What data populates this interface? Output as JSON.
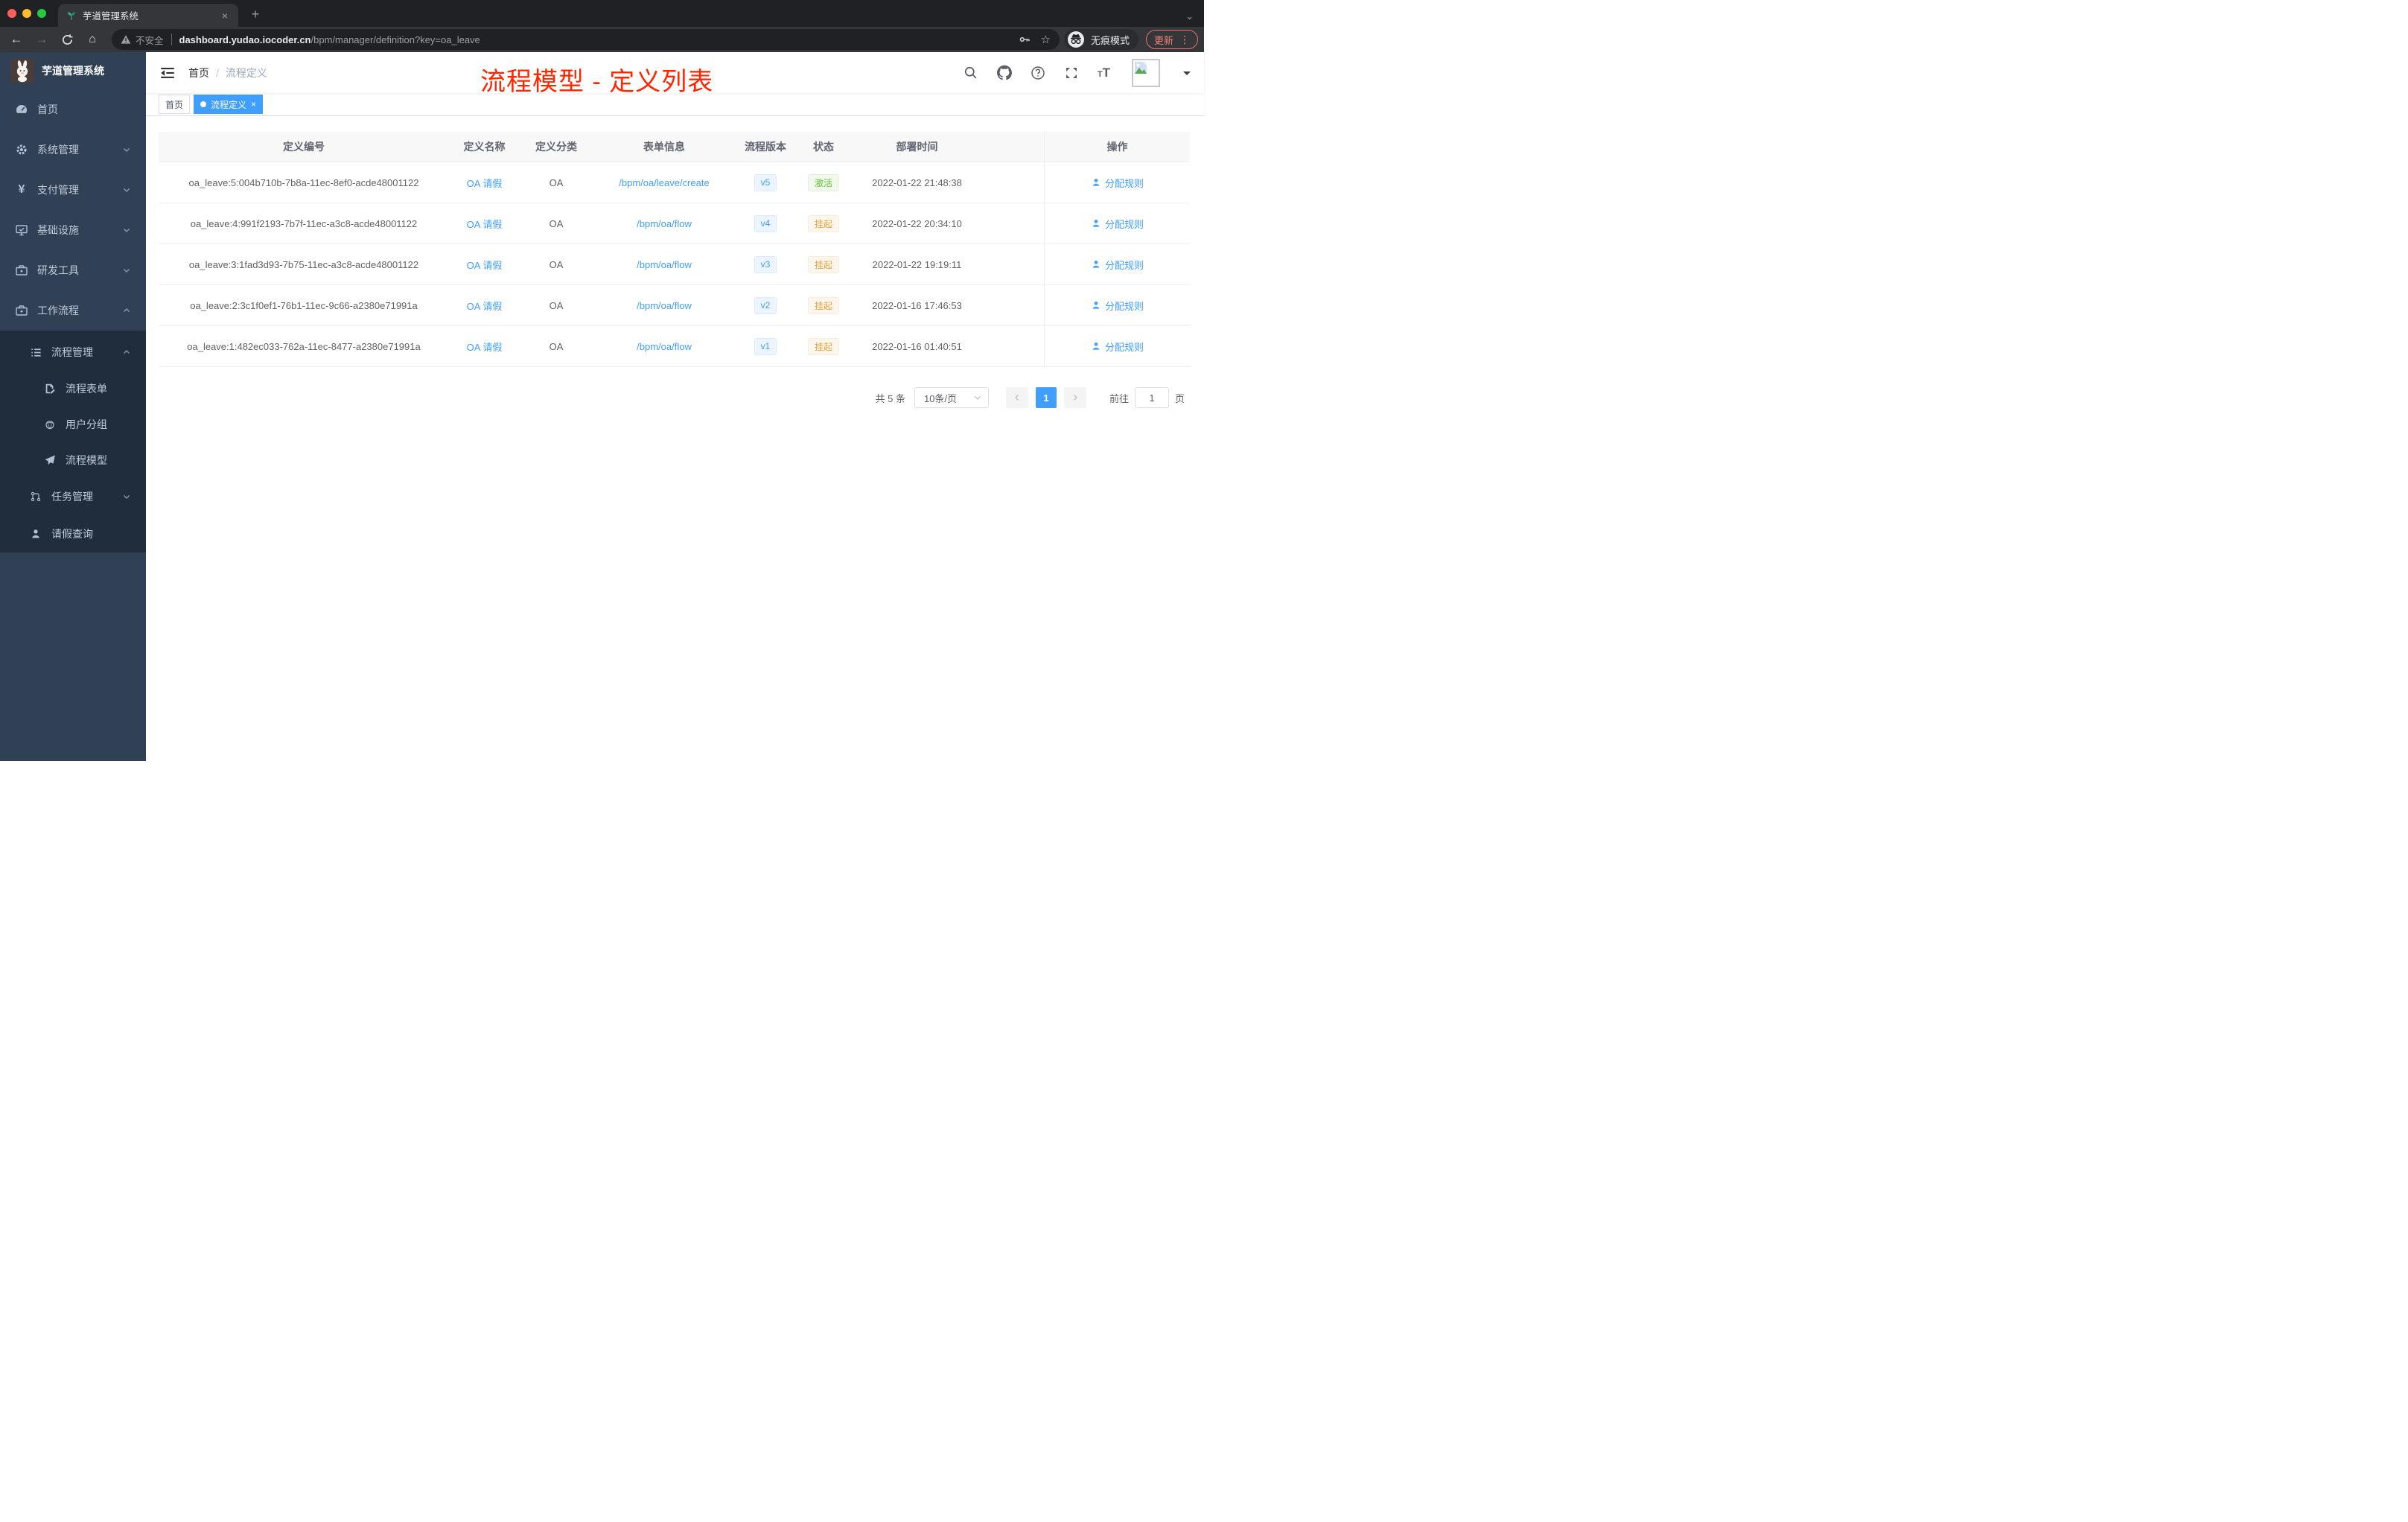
{
  "browser": {
    "tab_title": "芋道管理系统",
    "tab_close": "×",
    "new_tab": "+",
    "url": {
      "warning": "不安全",
      "host": "dashboard.yudao.iocoder.cn",
      "path": "/bpm/manager/definition?key=oa_leave"
    },
    "bookmark_star": "☆",
    "incognito_label": "无痕模式",
    "update_label": "更新",
    "kebab": "⋮",
    "back": "←",
    "forward": "→",
    "home": "⌂",
    "tab_overflow": "⌄"
  },
  "annotation": "流程模型 - 定义列表",
  "app": {
    "logo_title": "芋道管理系统",
    "breadcrumb": {
      "home": "首页",
      "separator": "/",
      "current": "流程定义"
    },
    "tags": [
      {
        "label": "首页"
      },
      {
        "label": "流程定义",
        "close": "×"
      }
    ],
    "sidebar": [
      {
        "label": "首页"
      },
      {
        "label": "系统管理"
      },
      {
        "label": "支付管理"
      },
      {
        "label": "基础设施"
      },
      {
        "label": "研发工具"
      },
      {
        "label": "工作流程"
      },
      {
        "label": "流程管理"
      },
      {
        "label": "流程表单"
      },
      {
        "label": "用户分组"
      },
      {
        "label": "流程模型"
      },
      {
        "label": "任务管理"
      },
      {
        "label": "请假查询"
      }
    ],
    "yen_icon": "¥"
  },
  "table": {
    "headers": [
      "定义编号",
      "定义名称",
      "定义分类",
      "表单信息",
      "流程版本",
      "状态",
      "部署时间",
      "操作"
    ],
    "rows": [
      {
        "id": "oa_leave:5:004b710b-7b8a-11ec-8ef0-acde48001122",
        "name": "OA 请假",
        "category": "OA",
        "form": "/bpm/oa/leave/create",
        "version": "v5",
        "status": "激活",
        "time": "2022-01-22 21:48:38",
        "action": "分配规则"
      },
      {
        "id": "oa_leave:4:991f2193-7b7f-11ec-a3c8-acde48001122",
        "name": "OA 请假",
        "category": "OA",
        "form": "/bpm/oa/flow",
        "version": "v4",
        "status": "挂起",
        "time": "2022-01-22 20:34:10",
        "action": "分配规则"
      },
      {
        "id": "oa_leave:3:1fad3d93-7b75-11ec-a3c8-acde48001122",
        "name": "OA 请假",
        "category": "OA",
        "form": "/bpm/oa/flow",
        "version": "v3",
        "status": "挂起",
        "time": "2022-01-22 19:19:11",
        "action": "分配规则"
      },
      {
        "id": "oa_leave:2:3c1f0ef1-76b1-11ec-9c66-a2380e71991a",
        "name": "OA 请假",
        "category": "OA",
        "form": "/bpm/oa/flow",
        "version": "v2",
        "status": "挂起",
        "time": "2022-01-16 17:46:53",
        "action": "分配规则"
      },
      {
        "id": "oa_leave:1:482ec033-762a-11ec-8477-a2380e71991a",
        "name": "OA 请假",
        "category": "OA",
        "form": "/bpm/oa/flow",
        "version": "v1",
        "status": "挂起",
        "time": "2022-01-16 01:40:51",
        "action": "分配规则"
      }
    ]
  },
  "pagination": {
    "total": "共 5 条",
    "page_size": "10条/页",
    "current_page": "1",
    "goto_label": "前往",
    "goto_value": "1",
    "page_unit": "页"
  },
  "colors": {
    "primary": "#409eff",
    "success": "#67c23a",
    "warning": "#e6a23c",
    "annotation": "#ff2600",
    "sidebar_bg": "#304156",
    "submenu_bg": "#1f2d3d"
  }
}
